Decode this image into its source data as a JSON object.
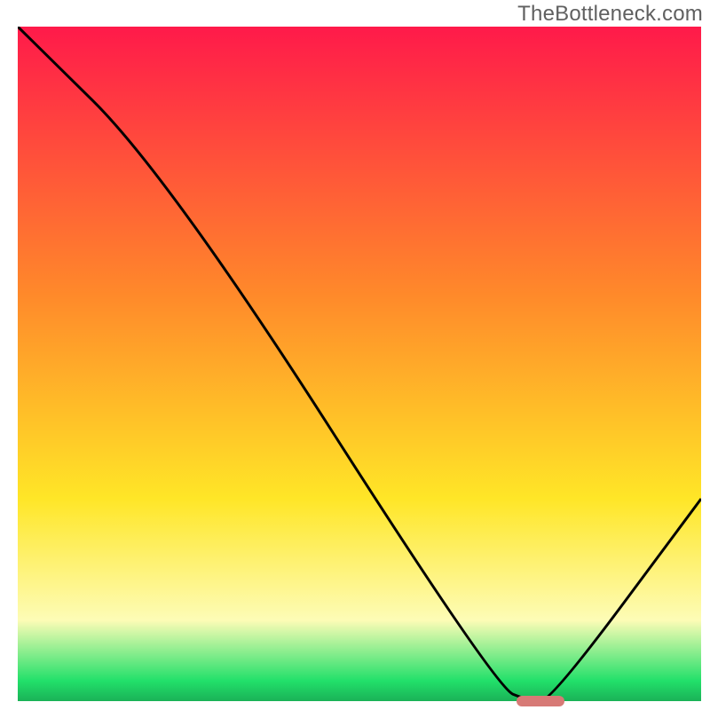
{
  "watermark": "TheBottleneck.com",
  "colors": {
    "gradient_top": "#ff1a4a",
    "gradient_mid1": "#ff8a2a",
    "gradient_mid2": "#ffe627",
    "gradient_pale": "#fdfcb6",
    "gradient_green": "#22e06a",
    "curve_stroke": "#000000",
    "marker_fill": "#d77a76"
  },
  "chart_data": {
    "type": "line",
    "title": "",
    "xlabel": "",
    "ylabel": "",
    "xlim": [
      0,
      100
    ],
    "ylim": [
      0,
      100
    ],
    "x": [
      0,
      22,
      70,
      75,
      78,
      100
    ],
    "values": [
      100,
      78,
      2,
      0,
      0,
      30
    ],
    "gradient_stops": [
      {
        "offset": 0.0,
        "color": "#ff1a4a"
      },
      {
        "offset": 0.4,
        "color": "#ff8a2a"
      },
      {
        "offset": 0.7,
        "color": "#ffe627"
      },
      {
        "offset": 0.88,
        "color": "#fdfcb6"
      },
      {
        "offset": 0.97,
        "color": "#22e06a"
      },
      {
        "offset": 1.0,
        "color": "#1ab257"
      }
    ],
    "marker": {
      "x_start": 73,
      "x_end": 80,
      "y": 0
    }
  }
}
